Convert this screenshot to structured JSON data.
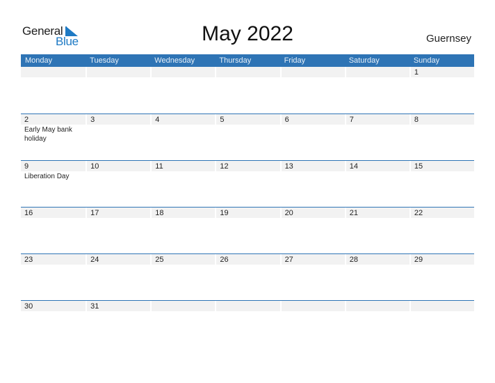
{
  "logo": {
    "line1": "General",
    "line2": "Blue",
    "icon": "triangle-flag-icon"
  },
  "title": "May 2022",
  "region": "Guernsey",
  "colors": {
    "header_bg": "#2e74b5",
    "row_bg": "#f2f2f2",
    "logo_blue": "#1e7ac4"
  },
  "weekdays": [
    "Monday",
    "Tuesday",
    "Wednesday",
    "Thursday",
    "Friday",
    "Saturday",
    "Sunday"
  ],
  "weeks": [
    {
      "days": [
        {
          "num": "",
          "event": ""
        },
        {
          "num": "",
          "event": ""
        },
        {
          "num": "",
          "event": ""
        },
        {
          "num": "",
          "event": ""
        },
        {
          "num": "",
          "event": ""
        },
        {
          "num": "",
          "event": ""
        },
        {
          "num": "1",
          "event": ""
        }
      ]
    },
    {
      "days": [
        {
          "num": "2",
          "event": "Early May bank holiday"
        },
        {
          "num": "3",
          "event": ""
        },
        {
          "num": "4",
          "event": ""
        },
        {
          "num": "5",
          "event": ""
        },
        {
          "num": "6",
          "event": ""
        },
        {
          "num": "7",
          "event": ""
        },
        {
          "num": "8",
          "event": ""
        }
      ]
    },
    {
      "days": [
        {
          "num": "9",
          "event": "Liberation Day"
        },
        {
          "num": "10",
          "event": ""
        },
        {
          "num": "11",
          "event": ""
        },
        {
          "num": "12",
          "event": ""
        },
        {
          "num": "13",
          "event": ""
        },
        {
          "num": "14",
          "event": ""
        },
        {
          "num": "15",
          "event": ""
        }
      ]
    },
    {
      "days": [
        {
          "num": "16",
          "event": ""
        },
        {
          "num": "17",
          "event": ""
        },
        {
          "num": "18",
          "event": ""
        },
        {
          "num": "19",
          "event": ""
        },
        {
          "num": "20",
          "event": ""
        },
        {
          "num": "21",
          "event": ""
        },
        {
          "num": "22",
          "event": ""
        }
      ]
    },
    {
      "days": [
        {
          "num": "23",
          "event": ""
        },
        {
          "num": "24",
          "event": ""
        },
        {
          "num": "25",
          "event": ""
        },
        {
          "num": "26",
          "event": ""
        },
        {
          "num": "27",
          "event": ""
        },
        {
          "num": "28",
          "event": ""
        },
        {
          "num": "29",
          "event": ""
        }
      ]
    },
    {
      "days": [
        {
          "num": "30",
          "event": ""
        },
        {
          "num": "31",
          "event": ""
        },
        {
          "num": "",
          "event": ""
        },
        {
          "num": "",
          "event": ""
        },
        {
          "num": "",
          "event": ""
        },
        {
          "num": "",
          "event": ""
        },
        {
          "num": "",
          "event": ""
        }
      ]
    }
  ]
}
